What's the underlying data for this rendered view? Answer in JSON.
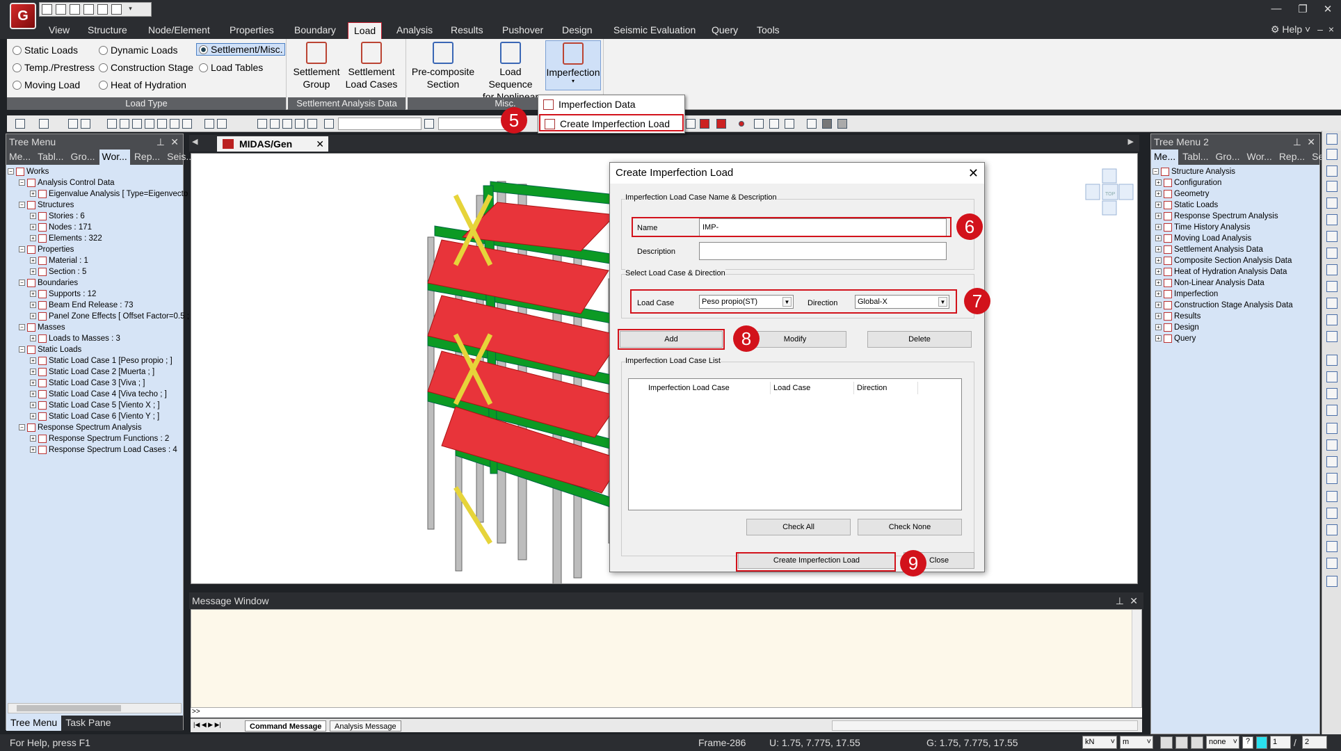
{
  "app": {
    "logo_text": "G"
  },
  "window_controls": {
    "minimize": "—",
    "restore": "❐",
    "close": "✕"
  },
  "ribbon_tabs": [
    "View",
    "Structure",
    "Node/Element",
    "Properties",
    "Boundary",
    "Load",
    "Analysis",
    "Results",
    "Pushover",
    "Design",
    "Seismic Evaluation",
    "Query",
    "Tools"
  ],
  "help": {
    "label": "Help"
  },
  "load_type": {
    "options": [
      "Static Loads",
      "Dynamic Loads",
      "Settlement/Misc.",
      "Temp./Prestress",
      "Construction Stage",
      "Load Tables",
      "Moving Load",
      "Heat of Hydration"
    ],
    "group_label": "Load Type"
  },
  "settlement": {
    "group_btn_line1": "Settlement",
    "group_btn_line2": "Group",
    "cases_btn_line1": "Settlement",
    "cases_btn_line2": "Load Cases",
    "group_label": "Settlement Analysis Data"
  },
  "misc": {
    "precomp_line1": "Pre-composite",
    "precomp_line2": "Section",
    "loadseq_line1": "Load Sequence",
    "loadseq_line2": "for Nonlinear",
    "imperfection_label": "Imperfection",
    "group_label": "Misc."
  },
  "dropdown": {
    "items": [
      "Imperfection Data",
      "Create Imperfection Load"
    ]
  },
  "tree_menu": {
    "title": "Tree Menu",
    "tabs": [
      "Me...",
      "Tabl...",
      "Gro...",
      "Wor...",
      "Rep...",
      "Seis..."
    ],
    "nodes": [
      {
        "label": "Works",
        "indent": 0
      },
      {
        "label": "Analysis Control Data",
        "indent": 1
      },
      {
        "label": "Eigenvalue Analysis [ Type=Eigenvecto",
        "indent": 2
      },
      {
        "label": "Structures",
        "indent": 1
      },
      {
        "label": "Stories : 6",
        "indent": 2
      },
      {
        "label": "Nodes : 171",
        "indent": 2
      },
      {
        "label": "Elements : 322",
        "indent": 2
      },
      {
        "label": "Properties",
        "indent": 1
      },
      {
        "label": "Material : 1",
        "indent": 2
      },
      {
        "label": "Section : 5",
        "indent": 2
      },
      {
        "label": "Boundaries",
        "indent": 1
      },
      {
        "label": "Supports : 12",
        "indent": 2
      },
      {
        "label": "Beam End Release : 73",
        "indent": 2
      },
      {
        "label": "Panel Zone Effects [ Offset Factor=0.5 ;",
        "indent": 2
      },
      {
        "label": "Masses",
        "indent": 1
      },
      {
        "label": "Loads to Masses : 3",
        "indent": 2
      },
      {
        "label": "Static Loads",
        "indent": 1
      },
      {
        "label": "Static Load Case 1 [Peso propio ; ]",
        "indent": 2
      },
      {
        "label": "Static Load Case 2 [Muerta ; ]",
        "indent": 2
      },
      {
        "label": "Static Load Case 3 [Viva ; ]",
        "indent": 2
      },
      {
        "label": "Static Load Case 4 [Viva techo ; ]",
        "indent": 2
      },
      {
        "label": "Static Load Case 5 [Viento X ; ]",
        "indent": 2
      },
      {
        "label": "Static Load Case 6 [Viento Y ; ]",
        "indent": 2
      },
      {
        "label": "Response Spectrum Analysis",
        "indent": 1
      },
      {
        "label": "Response Spectrum Functions : 2",
        "indent": 2
      },
      {
        "label": "Response Spectrum Load Cases : 4",
        "indent": 2
      }
    ],
    "bottom_tabs": [
      "Tree Menu",
      "Task Pane"
    ]
  },
  "tree_menu_2": {
    "title": "Tree Menu 2",
    "tabs": [
      "Me...",
      "Tabl...",
      "Gro...",
      "Wor...",
      "Rep...",
      "Seis..."
    ],
    "nodes": [
      "Structure Analysis",
      "Configuration",
      "Geometry",
      "Static Loads",
      "Response Spectrum Analysis",
      "Time History Analysis",
      "Moving Load Analysis",
      "Settlement Analysis Data",
      "Composite Section Analysis Data",
      "Heat of Hydration Analysis Data",
      "Non-Linear Analysis Data",
      "Imperfection",
      "Construction Stage Analysis Data",
      "Results",
      "Design",
      "Query"
    ]
  },
  "document": {
    "tab_label": "MIDAS/Gen",
    "view_cube_label": "TOP"
  },
  "dialog": {
    "title": "Create Imperfection Load",
    "section1_label": "Imperfection Load Case Name & Description",
    "name_label": "Name",
    "name_value": "IMP-",
    "description_label": "Description",
    "description_value": "",
    "section2_label": "Select Load Case & Direction",
    "load_case_label": "Load Case",
    "load_case_value": "Peso propio(ST)",
    "direction_label": "Direction",
    "direction_value": "Global-X",
    "add_label": "Add",
    "modify_label": "Modify",
    "delete_label": "Delete",
    "list_label": "Imperfection Load Case List",
    "columns": [
      "Imperfection Load Case",
      "Load Case",
      "Direction"
    ],
    "check_all_label": "Check All",
    "check_none_label": "Check None",
    "create_label": "Create Imperfection Load",
    "close_label": "Close"
  },
  "steps": [
    "5",
    "6",
    "7",
    "8",
    "9"
  ],
  "message_window": {
    "title": "Message Window",
    "prompt": ">>",
    "tabs": [
      "Command Message",
      "Analysis Message"
    ]
  },
  "status": {
    "help_text": "For Help, press F1",
    "frame": "Frame-286",
    "u_coords": "U: 1.75, 7.775, 17.55",
    "g_coords": "G: 1.75, 7.775, 17.55",
    "force_unit": "kN",
    "length_unit": "m",
    "snap_value": "none",
    "page_value": "1",
    "page_total": "2"
  },
  "colors": {
    "highlight": "#d2121b",
    "panel_bg": "#d6e4f6",
    "chrome": "#2b2d31"
  }
}
